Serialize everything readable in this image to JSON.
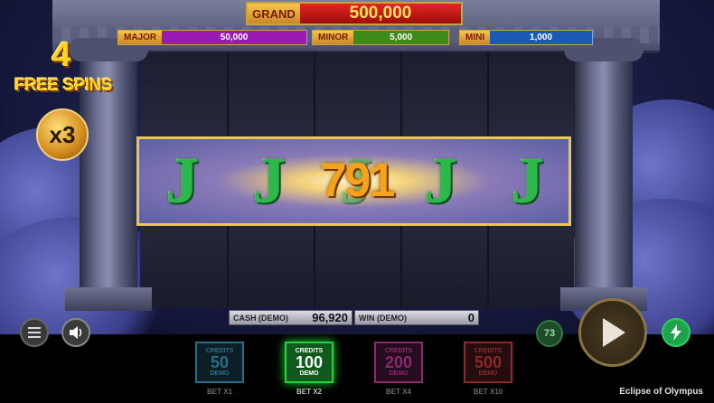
{
  "jackpots": {
    "grand": {
      "label": "GRAND",
      "value": "500,000"
    },
    "major": {
      "label": "MAJOR",
      "value": "50,000",
      "color": "#9a1ab4"
    },
    "minor": {
      "label": "MINOR",
      "value": "5,000",
      "color": "#3e8a1a"
    },
    "mini": {
      "label": "MINI",
      "value": "1,000",
      "color": "#1a5ab4"
    }
  },
  "free_spins": {
    "count": "4",
    "label": "FREE SPINS",
    "multiplier": "x3"
  },
  "reels": {
    "winning_row_symbols": [
      "J",
      "J",
      "J",
      "J",
      "J"
    ],
    "win_amount": "791"
  },
  "readouts": {
    "cash": {
      "label": "CASH (DEMO)",
      "value": "96,920"
    },
    "win": {
      "label": "WIN (DEMO)",
      "value": "0"
    }
  },
  "controls": {
    "menu_icon": "hamburger-menu-icon",
    "sound_icon": "speaker-icon",
    "autoplay_count": "73",
    "spin_icon": "play-icon",
    "turbo_icon": "lightning-icon"
  },
  "bets": [
    {
      "credits_label": "CREDITS",
      "value": "50",
      "demo_label": "DEMO",
      "bet_label": "BET X1",
      "color": "#2a6f8a",
      "selected": false
    },
    {
      "credits_label": "CREDITS",
      "value": "100",
      "demo_label": "DEMO",
      "bet_label": "BET X2",
      "color": "#1fd33a",
      "selected": true
    },
    {
      "credits_label": "CREDITS",
      "value": "200",
      "demo_label": "DEMO",
      "bet_label": "BET X4",
      "color": "#8a2a6f",
      "selected": false
    },
    {
      "credits_label": "CREDITS",
      "value": "500",
      "demo_label": "DEMO",
      "bet_label": "BET X10",
      "color": "#8a2a2a",
      "selected": false
    }
  ],
  "game_title": "Eclipse of Olympus"
}
